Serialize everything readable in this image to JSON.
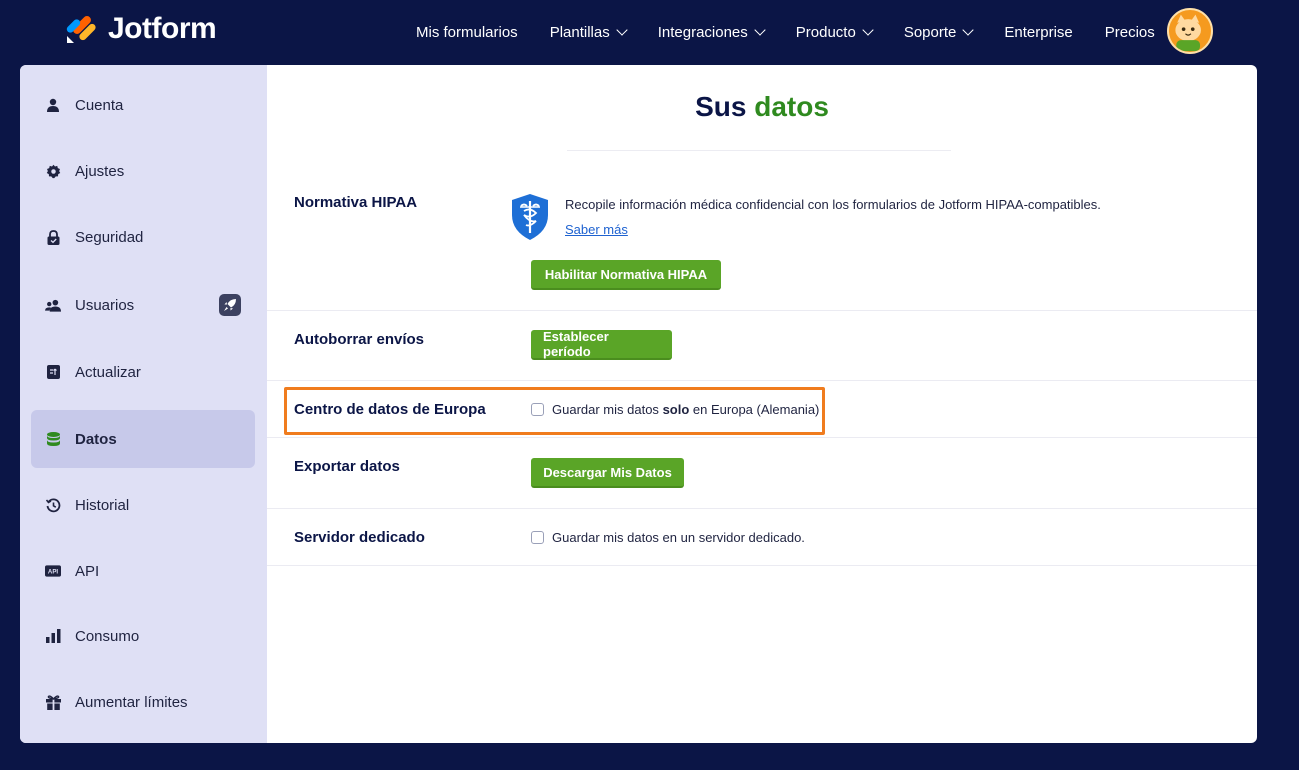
{
  "header": {
    "brand": "Jotform",
    "nav": [
      {
        "label": "Mis formularios",
        "dropdown": false
      },
      {
        "label": "Plantillas",
        "dropdown": true
      },
      {
        "label": "Integraciones",
        "dropdown": true
      },
      {
        "label": "Producto",
        "dropdown": true
      },
      {
        "label": "Soporte",
        "dropdown": true
      },
      {
        "label": "Enterprise",
        "dropdown": false
      },
      {
        "label": "Precios",
        "dropdown": false
      }
    ]
  },
  "sidebar": {
    "items": [
      {
        "label": "Cuenta",
        "icon": "user-icon"
      },
      {
        "label": "Ajustes",
        "icon": "gear-icon"
      },
      {
        "label": "Seguridad",
        "icon": "lock-icon"
      },
      {
        "label": "Usuarios",
        "icon": "users-icon"
      },
      {
        "label": "Actualizar",
        "icon": "upgrade-icon"
      },
      {
        "label": "Datos",
        "icon": "database-icon",
        "active": true
      },
      {
        "label": "Historial",
        "icon": "history-icon"
      },
      {
        "label": "API",
        "icon": "api-icon"
      },
      {
        "label": "Consumo",
        "icon": "bar-chart-icon"
      },
      {
        "label": "Aumentar límites",
        "icon": "gift-icon"
      }
    ]
  },
  "main": {
    "title_part1": "Sus",
    "title_part2": "datos",
    "hipaa": {
      "label": "Normativa HIPAA",
      "description": "Recopile información médica confidencial con los formularios de Jotform HIPAA-compatibles.",
      "link": "Saber más",
      "button": "Habilitar Normativa HIPAA"
    },
    "autodelete": {
      "label": "Autoborrar envíos",
      "button": "Establecer período"
    },
    "europe": {
      "label": "Centro de datos de Europa",
      "text_before": "Guardar mis datos",
      "text_bold": "solo",
      "text_after": "en Europa (Alemania)",
      "checked": false
    },
    "export": {
      "label": "Exportar datos",
      "button": "Descargar Mis Datos"
    },
    "dedicated": {
      "label": "Servidor dedicado",
      "text": "Guardar mis datos en un servidor dedicado.",
      "checked": false
    }
  },
  "colors": {
    "navy": "#0b1546",
    "green": "#5aa527",
    "highlight": "#f07c1e",
    "sidebar": "#dfe0f5"
  }
}
